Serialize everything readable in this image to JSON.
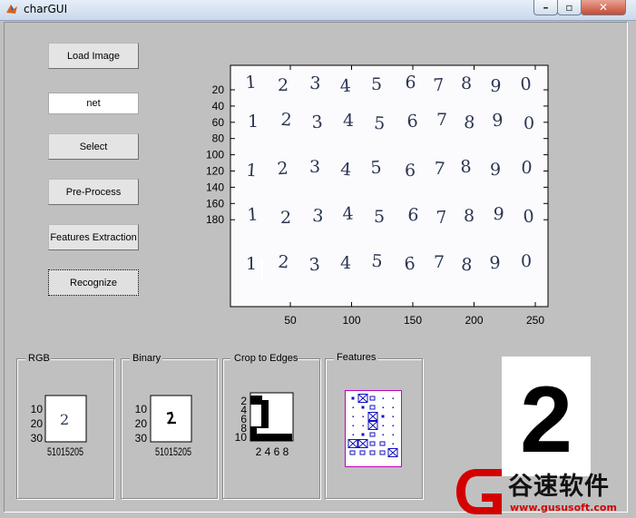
{
  "window": {
    "title": "charGUI",
    "minimize_glyph": "–",
    "maximize_glyph": "▫",
    "close_glyph": "✕"
  },
  "controls": {
    "load_image": "Load Image",
    "net_value": "net",
    "select": "Select",
    "pre_process": "Pre-Process",
    "features_extraction": "Features Extraction",
    "recognize": "Recognize"
  },
  "main_plot": {
    "y_ticks": [
      "20",
      "40",
      "60",
      "80",
      "100",
      "120",
      "140",
      "160",
      "180"
    ],
    "x_ticks": [
      "50",
      "100",
      "150",
      "200",
      "250"
    ],
    "digit_rows": [
      [
        "1",
        "2",
        "3",
        "4",
        "5",
        "6",
        "7",
        "8",
        "9",
        "0"
      ],
      [
        "1",
        "2",
        "3",
        "4",
        "5",
        "6",
        "7",
        "8",
        "9",
        "0"
      ],
      [
        "1",
        "2",
        "3",
        "4",
        "5",
        "6",
        "7",
        "8",
        "9",
        "0"
      ],
      [
        "1",
        "2",
        "3",
        "4",
        "5",
        "6",
        "7",
        "8",
        "9",
        "0"
      ],
      [
        "1",
        "2",
        "3",
        "4",
        "5",
        "6",
        "7",
        "8",
        "9",
        "0"
      ]
    ]
  },
  "panels": {
    "rgb": {
      "title": "RGB",
      "y_ticks": [
        "10",
        "20",
        "30"
      ],
      "x_ticks": "51015205",
      "digit": "2"
    },
    "binary": {
      "title": "Binary",
      "y_ticks": [
        "10",
        "20",
        "30"
      ],
      "x_ticks": "51015205"
    },
    "crop": {
      "title": "Crop to Edges",
      "y_ticks": [
        "2",
        "4",
        "6",
        "8",
        "10"
      ],
      "x_ticks": "2 4 6 8"
    },
    "features": {
      "title": "Features"
    }
  },
  "result": {
    "digit": "2"
  },
  "watermark": {
    "brand": "谷速软件",
    "url": "www.gususoft.com",
    "colors": {
      "red": "#d40000",
      "dark": "#111111"
    }
  },
  "colors": {
    "window_bg": "#c0c0c0",
    "features_frame": "#c000c0",
    "features_marks": "#1010c0"
  }
}
